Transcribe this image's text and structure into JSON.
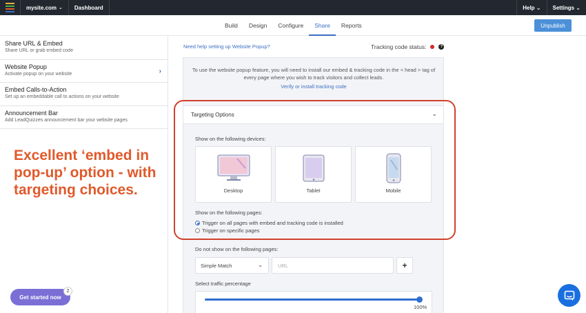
{
  "topbar": {
    "site": "mysite.com",
    "dashboard": "Dashboard",
    "help": "Help",
    "settings": "Settings",
    "logo_colors": [
      "#e8b339",
      "#4caf50",
      "#e05a2b",
      "#3d6fc4"
    ]
  },
  "nav": {
    "tabs": [
      "Build",
      "Design",
      "Configure",
      "Share",
      "Reports"
    ],
    "active_tab": "Share",
    "unpublish": "Unpublish"
  },
  "sidebar": {
    "items": [
      {
        "title": "Share URL & Embed",
        "subtitle": "Share URL or grab embed code"
      },
      {
        "title": "Website Popup",
        "subtitle": "Activate popup on your website"
      },
      {
        "title": "Embed Calls-to-Action",
        "subtitle": "Set up an embeddable call to actions on your website"
      },
      {
        "title": "Announcement Bar",
        "subtitle": "Add LeadQuizzes announcement bar your website pages"
      }
    ],
    "annotation": "Excellent ‘embed in pop-up’ option - with targeting choices.",
    "get_started": "Get started now",
    "badge": "2"
  },
  "main": {
    "help_link": "Need help setting up Website Popup?",
    "tracking_status": "Tracking code status:",
    "info_text": "To use the website popup feature, you will need to install our embed & tracking code in the < head > tag of every page where you wish to track visitors and collect leads.",
    "verify_link": "Verify or install tracking code",
    "targeting": {
      "title": "Targeting Options",
      "devices_label": "Show on the following devices:",
      "devices": [
        "Desktop",
        "Tablet",
        "Mobile"
      ],
      "pages_label": "Show on the following pages:",
      "page_options": [
        {
          "label": "Trigger on all pages with embed and tracking code is installed",
          "selected": true
        },
        {
          "label": "Trigger on specific pages",
          "selected": false
        }
      ]
    },
    "exclude": {
      "label": "Do not show on the following pages:",
      "match": "Simple Match",
      "url_placeholder": "URL"
    },
    "traffic": {
      "label": "Select traffic percentage",
      "value": "100%"
    }
  },
  "colors": {
    "accent": "#3d6fc4",
    "annotation": "#e05a2b",
    "status_dot": "#d42a2a"
  }
}
